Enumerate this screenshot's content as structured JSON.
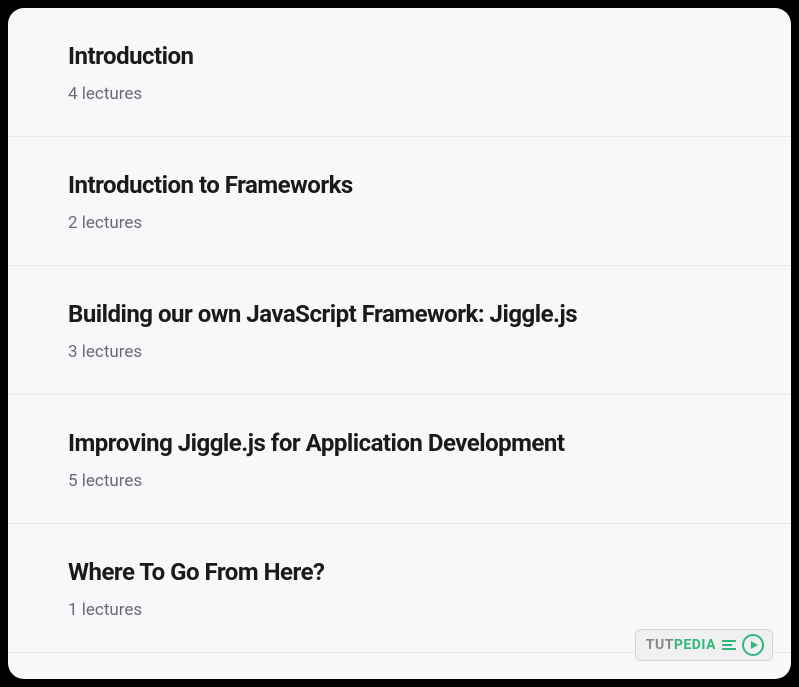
{
  "sections": [
    {
      "title": "Introduction",
      "subtitle": "4 lectures"
    },
    {
      "title": "Introduction to Frameworks",
      "subtitle": "2 lectures"
    },
    {
      "title": "Building our own JavaScript Framework: Jiggle.js",
      "subtitle": "3 lectures"
    },
    {
      "title": "Improving Jiggle.js for Application Development",
      "subtitle": "5 lectures"
    },
    {
      "title": "Where To Go From Here?",
      "subtitle": "1 lectures"
    }
  ],
  "watermark": {
    "prefix": "TUT",
    "suffix": "PEDIA"
  }
}
